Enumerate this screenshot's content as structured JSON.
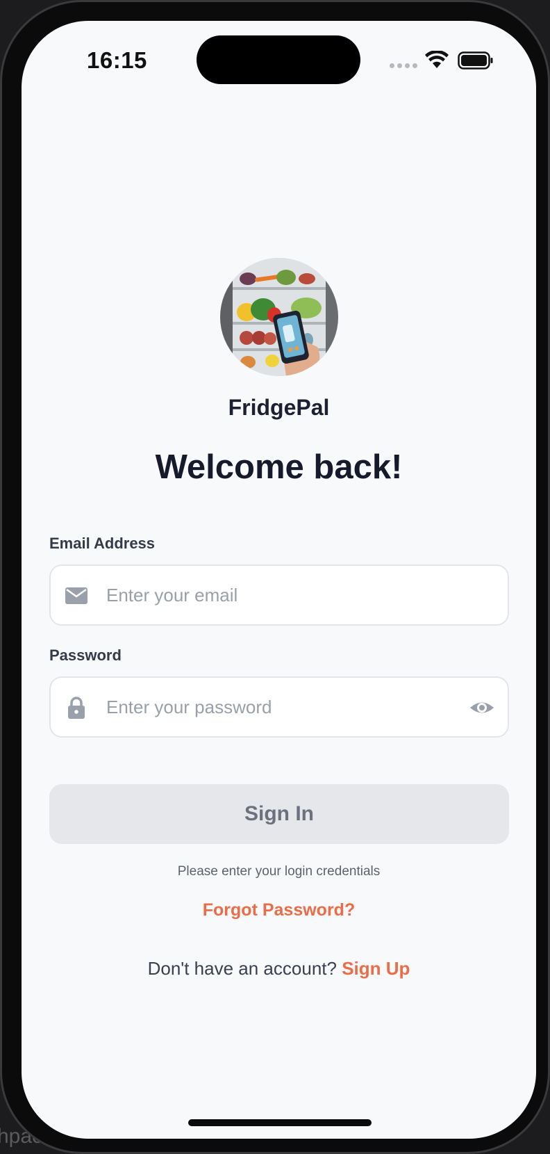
{
  "status_bar": {
    "time": "16:15"
  },
  "app": {
    "name": "FridgePal",
    "welcome": "Welcome back!"
  },
  "form": {
    "email_label": "Email Address",
    "email_placeholder": "Enter your email",
    "password_label": "Password",
    "password_placeholder": "Enter your password",
    "signin_label": "Sign In",
    "hint": "Please enter your login credentials",
    "forgot_label": "Forgot Password?",
    "signup_prompt": "Don't have an account?",
    "signup_label": "Sign Up"
  },
  "background": {
    "partial_text": "hpac"
  },
  "icons": {
    "email": "envelope-icon",
    "password": "lock-icon",
    "visibility": "eye-icon",
    "wifi": "wifi-icon",
    "battery": "battery-icon"
  },
  "colors": {
    "accent": "#ea6d48",
    "title": "#161a2b",
    "button_disabled_bg": "#e6e7ea",
    "screen_bg": "#f8f9fb"
  }
}
